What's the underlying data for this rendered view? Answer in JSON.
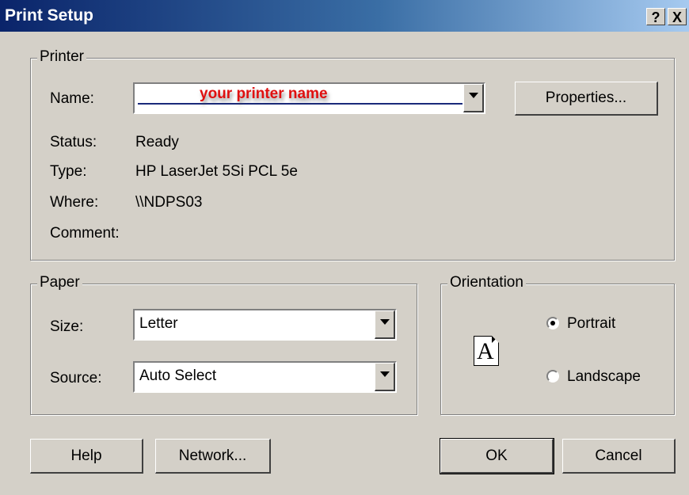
{
  "window": {
    "title": "Print Setup",
    "help_glyph": "?",
    "close_glyph": "X"
  },
  "printer": {
    "legend": "Printer",
    "name_label": "Name:",
    "name_value": "your printer name",
    "properties_label": "Properties...",
    "status_label": "Status:",
    "status_value": "Ready",
    "type_label": "Type:",
    "type_value": "HP LaserJet 5Si PCL 5e",
    "where_label": "Where:",
    "where_value": "\\\\NDPS03",
    "comment_label": "Comment:"
  },
  "paper": {
    "legend": "Paper",
    "size_label": "Size:",
    "size_value": "Letter",
    "source_label": "Source:",
    "source_value": "Auto Select"
  },
  "orientation": {
    "legend": "Orientation",
    "icon_letter": "A",
    "portrait_label": "Portrait",
    "landscape_label": "Landscape",
    "selected": "portrait"
  },
  "buttons": {
    "help": "Help",
    "network": "Network...",
    "ok": "OK",
    "cancel": "Cancel"
  },
  "colors": {
    "face": "#d4d0c8",
    "title_start": "#0a246a",
    "title_end": "#a6caf0",
    "annotation_red": "#e01010"
  }
}
